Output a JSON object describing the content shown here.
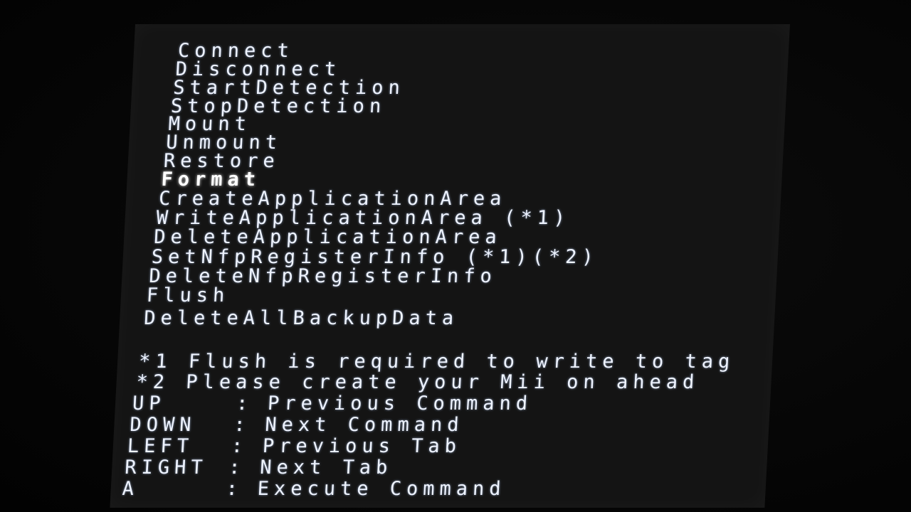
{
  "menu": {
    "items": [
      {
        "label": "Connect"
      },
      {
        "label": "Disconnect"
      },
      {
        "label": "StartDetection"
      },
      {
        "label": "StopDetection"
      },
      {
        "label": "Mount"
      },
      {
        "label": "Unmount"
      },
      {
        "label": "Restore"
      },
      {
        "label": "Format",
        "selected": true
      },
      {
        "label": "CreateApplicationArea"
      },
      {
        "label": "WriteApplicationArea (*1)"
      },
      {
        "label": "DeleteApplicationArea"
      },
      {
        "label": "SetNfpRegisterInfo (*1)(*2)"
      },
      {
        "label": "DeleteNfpRegisterInfo"
      },
      {
        "label": "Flush"
      },
      {
        "label": "DeleteAllBackupData"
      }
    ]
  },
  "notes": [
    "*1 Flush is required to write to tag",
    "*2 Please create your Mii on ahead"
  ],
  "controls": [
    {
      "key": "UP",
      "separator": ":",
      "action": "Previous Command"
    },
    {
      "key": "DOWN",
      "separator": ":",
      "action": "Next Command"
    },
    {
      "key": "LEFT",
      "separator": ":",
      "action": "Previous Tab"
    },
    {
      "key": "RIGHT",
      "separator": ":",
      "action": "Next Tab"
    },
    {
      "key": "A",
      "separator": ":",
      "action": "Execute Command"
    }
  ]
}
